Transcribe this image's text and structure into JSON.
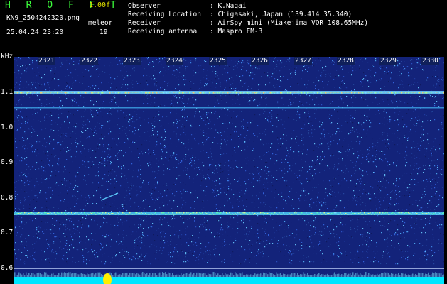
{
  "header": {
    "brand": "H R O F F T",
    "version": "1.00f",
    "file_name": "KN9_2504242320.png",
    "mode": "meleor",
    "date_time": "25.04.24 23:20",
    "count": "19"
  },
  "info": {
    "observer_label": "Observer",
    "observer_value": ": K.Nagai",
    "location_label": "Receiving Location",
    "location_value": ": Chigasaki, Japan (139.414 35.340)",
    "receiver_label": "Receiver",
    "receiver_value": ": AirSpy mini (Miakejima VOR 108.65MHz)",
    "antenna_label": "Receiving antenna",
    "antenna_value": ": Maspro FM-3"
  },
  "axis": {
    "unit": "kHz",
    "y_ticks": [
      "1.1",
      "1.0",
      "0.9",
      "0.8",
      "0.7",
      "0.6"
    ],
    "x_ticks": [
      "2321",
      "2322",
      "2323",
      "2324",
      "2325",
      "2326",
      "2327",
      "2328",
      "2329",
      "2330"
    ]
  },
  "colors": {
    "background": "#000000",
    "spectrogram": "#13237a",
    "brand": "#3cff3c",
    "version": "#e6e600",
    "floor": "#00e5ff",
    "marker": "#ffee00"
  }
}
